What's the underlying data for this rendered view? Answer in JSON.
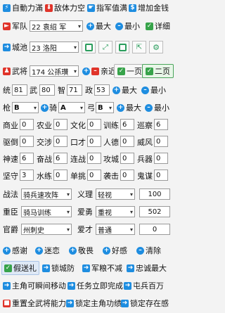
{
  "top": {
    "auto_full": "自動力滿",
    "enemy_empty": "敌体力空",
    "fill_value": "指军值满",
    "add_gold": "增加金钱"
  },
  "army": {
    "label": "军队",
    "select": "22 袁绍 军",
    "max": "最大",
    "min": "最小",
    "detail": "详细"
  },
  "city": {
    "label": "城池",
    "select": "23 洛阳"
  },
  "general": {
    "label": "武将",
    "select": "174 公孫瓚",
    "close": "亲近",
    "one_page": "一页",
    "two_page": "二页"
  },
  "stats": {
    "tong_label": "统",
    "tong": "81",
    "wu_label": "武",
    "wu": "80",
    "zhi_label": "智",
    "zhi": "71",
    "zheng_label": "政",
    "zheng": "53",
    "max": "最大",
    "min": "最小"
  },
  "weapons": {
    "spear_label": "枪",
    "spear": "B",
    "horse_label": "骑",
    "horse": "A",
    "bow_label": "弓",
    "bow": "B",
    "max": "最大",
    "min": "最小"
  },
  "skills": [
    [
      {
        "k": "商业",
        "v": "0"
      },
      {
        "k": "农业",
        "v": "0"
      },
      {
        "k": "文化",
        "v": "0"
      },
      {
        "k": "训练",
        "v": "6"
      },
      {
        "k": "巡察",
        "v": "6"
      }
    ],
    [
      {
        "k": "驱倒",
        "v": "0"
      },
      {
        "k": "交涉",
        "v": "0"
      },
      {
        "k": "口才",
        "v": "0"
      },
      {
        "k": "人德",
        "v": "0"
      },
      {
        "k": "威风",
        "v": "0"
      }
    ],
    [
      {
        "k": "神速",
        "v": "6"
      },
      {
        "k": "奋战",
        "v": "6"
      },
      {
        "k": "连战",
        "v": "0"
      },
      {
        "k": "攻城",
        "v": "0"
      },
      {
        "k": "兵器",
        "v": "0"
      }
    ],
    [
      {
        "k": "坚守",
        "v": "3"
      },
      {
        "k": "水练",
        "v": "0"
      },
      {
        "k": "单挑",
        "v": "0"
      },
      {
        "k": "袭击",
        "v": "0"
      },
      {
        "k": "鬼谋",
        "v": "0"
      }
    ]
  ],
  "tactics": {
    "label": "战法",
    "value": "骑兵速攻阵",
    "righteous_label": "义理",
    "righteous": "轻视",
    "num": "100"
  },
  "valued": {
    "label": "重臣",
    "value": "骑马训练",
    "love_label": "爱勇",
    "love": "重视",
    "num": "502"
  },
  "office": {
    "label": "官爵",
    "value": "州刺史",
    "talent_label": "爱才",
    "talent": "普通",
    "num": "0"
  },
  "actions1": [
    "感谢",
    "迷恋",
    "敬畏",
    "好感",
    "清除"
  ],
  "actions2": [
    "假送礼",
    "锁城防",
    "军粮不减",
    "忠诚最大"
  ],
  "actions3": [
    "主角可瞬间移动",
    "任务立即完成",
    "屯兵百万"
  ],
  "actions4": [
    "重置全武将能力",
    "锁定主角功绩",
    "锁定存在感"
  ]
}
